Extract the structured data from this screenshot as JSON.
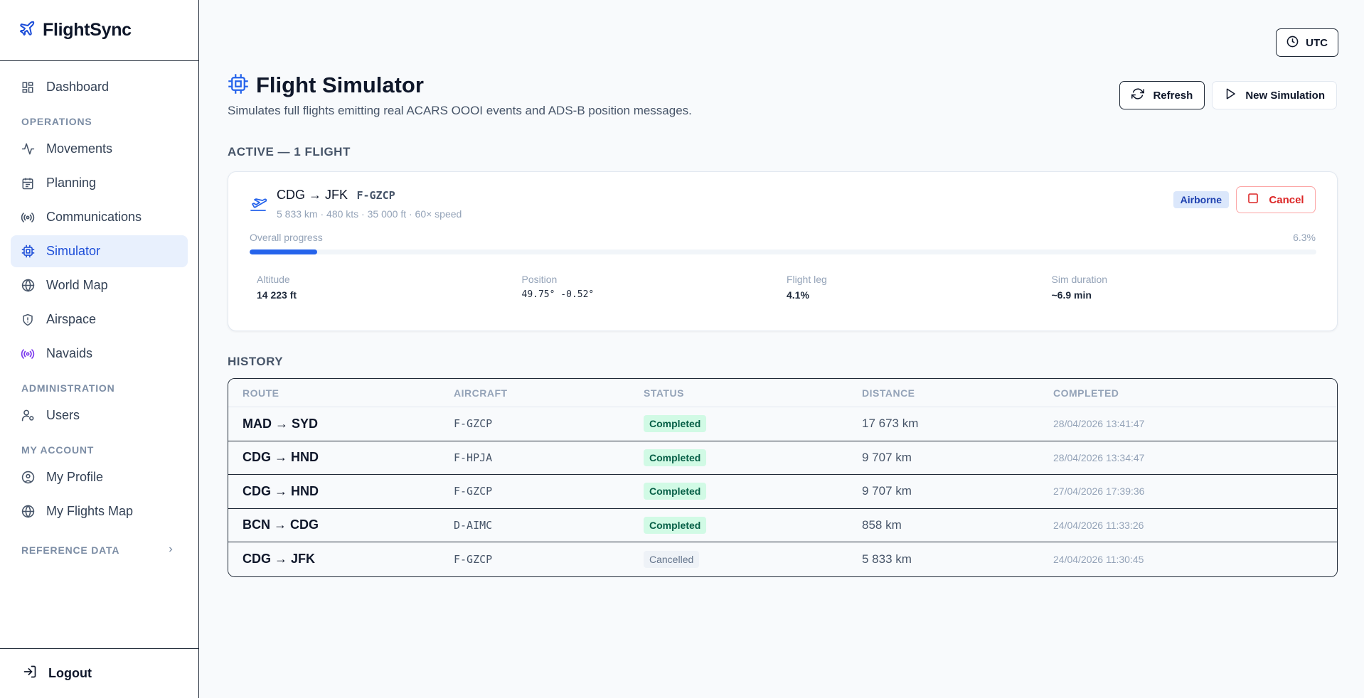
{
  "app": {
    "name": "FlightSync"
  },
  "sidebar": {
    "dashboard": "Dashboard",
    "operations_label": "OPERATIONS",
    "operations": [
      {
        "label": "Movements",
        "icon": "activity-icon"
      },
      {
        "label": "Planning",
        "icon": "calendar-icon"
      },
      {
        "label": "Communications",
        "icon": "radio-icon"
      },
      {
        "label": "Simulator",
        "icon": "cpu-icon",
        "active": true
      },
      {
        "label": "World Map",
        "icon": "globe-icon"
      },
      {
        "label": "Airspace",
        "icon": "shield-icon"
      },
      {
        "label": "Navaids",
        "icon": "radio-icon"
      }
    ],
    "admin_label": "ADMINISTRATION",
    "users": "Users",
    "account_label": "MY ACCOUNT",
    "my_profile": "My Profile",
    "my_flights_map": "My Flights Map",
    "reference_label": "REFERENCE DATA",
    "logout": "Logout"
  },
  "topbar": {
    "utc": "UTC"
  },
  "header": {
    "title": "Flight Simulator",
    "subtitle": "Simulates full flights emitting real ACARS OOOI events and ADS-B position messages.",
    "refresh": "Refresh",
    "new_simulation": "New Simulation"
  },
  "active": {
    "heading": "ACTIVE — 1 FLIGHT",
    "flight": {
      "route": "CDG → JFK",
      "registration": "F-GZCP",
      "meta": "5 833 km · 480 kts · 35 000 ft · 60× speed",
      "status": "Airborne",
      "cancel": "Cancel",
      "progress_label": "Overall progress",
      "progress_text": "6.3%",
      "progress": 0.063,
      "stats": [
        {
          "label": "Altitude",
          "value": "14 223 ft"
        },
        {
          "label": "Position",
          "value": "49.75° -0.52°"
        },
        {
          "label": "Flight leg",
          "value": "4.1%"
        },
        {
          "label": "Sim duration",
          "value": "~6.9 min"
        }
      ]
    }
  },
  "history": {
    "heading": "HISTORY",
    "columns": [
      "ROUTE",
      "AIRCRAFT",
      "STATUS",
      "DISTANCE",
      "COMPLETED"
    ],
    "rows": [
      {
        "route": "MAD → SYD",
        "aircraft": "F-GZCP",
        "status": "Completed",
        "distance": "17 673 km",
        "completed": "28/04/2026 13:41:47"
      },
      {
        "route": "CDG → HND",
        "aircraft": "F-HPJA",
        "status": "Completed",
        "distance": "9 707 km",
        "completed": "28/04/2026 13:34:47"
      },
      {
        "route": "CDG → HND",
        "aircraft": "F-GZCP",
        "status": "Completed",
        "distance": "9 707 km",
        "completed": "27/04/2026 17:39:36"
      },
      {
        "route": "BCN → CDG",
        "aircraft": "D-AIMC",
        "status": "Completed",
        "distance": "858 km",
        "completed": "24/04/2026 11:33:26"
      },
      {
        "route": "CDG → JFK",
        "aircraft": "F-GZCP",
        "status": "Cancelled",
        "distance": "5 833 km",
        "completed": "24/04/2026 11:30:45"
      }
    ]
  },
  "colors": {
    "accent": "#2563eb",
    "navaids": "#7c3aed",
    "danger": "#dc2626"
  }
}
